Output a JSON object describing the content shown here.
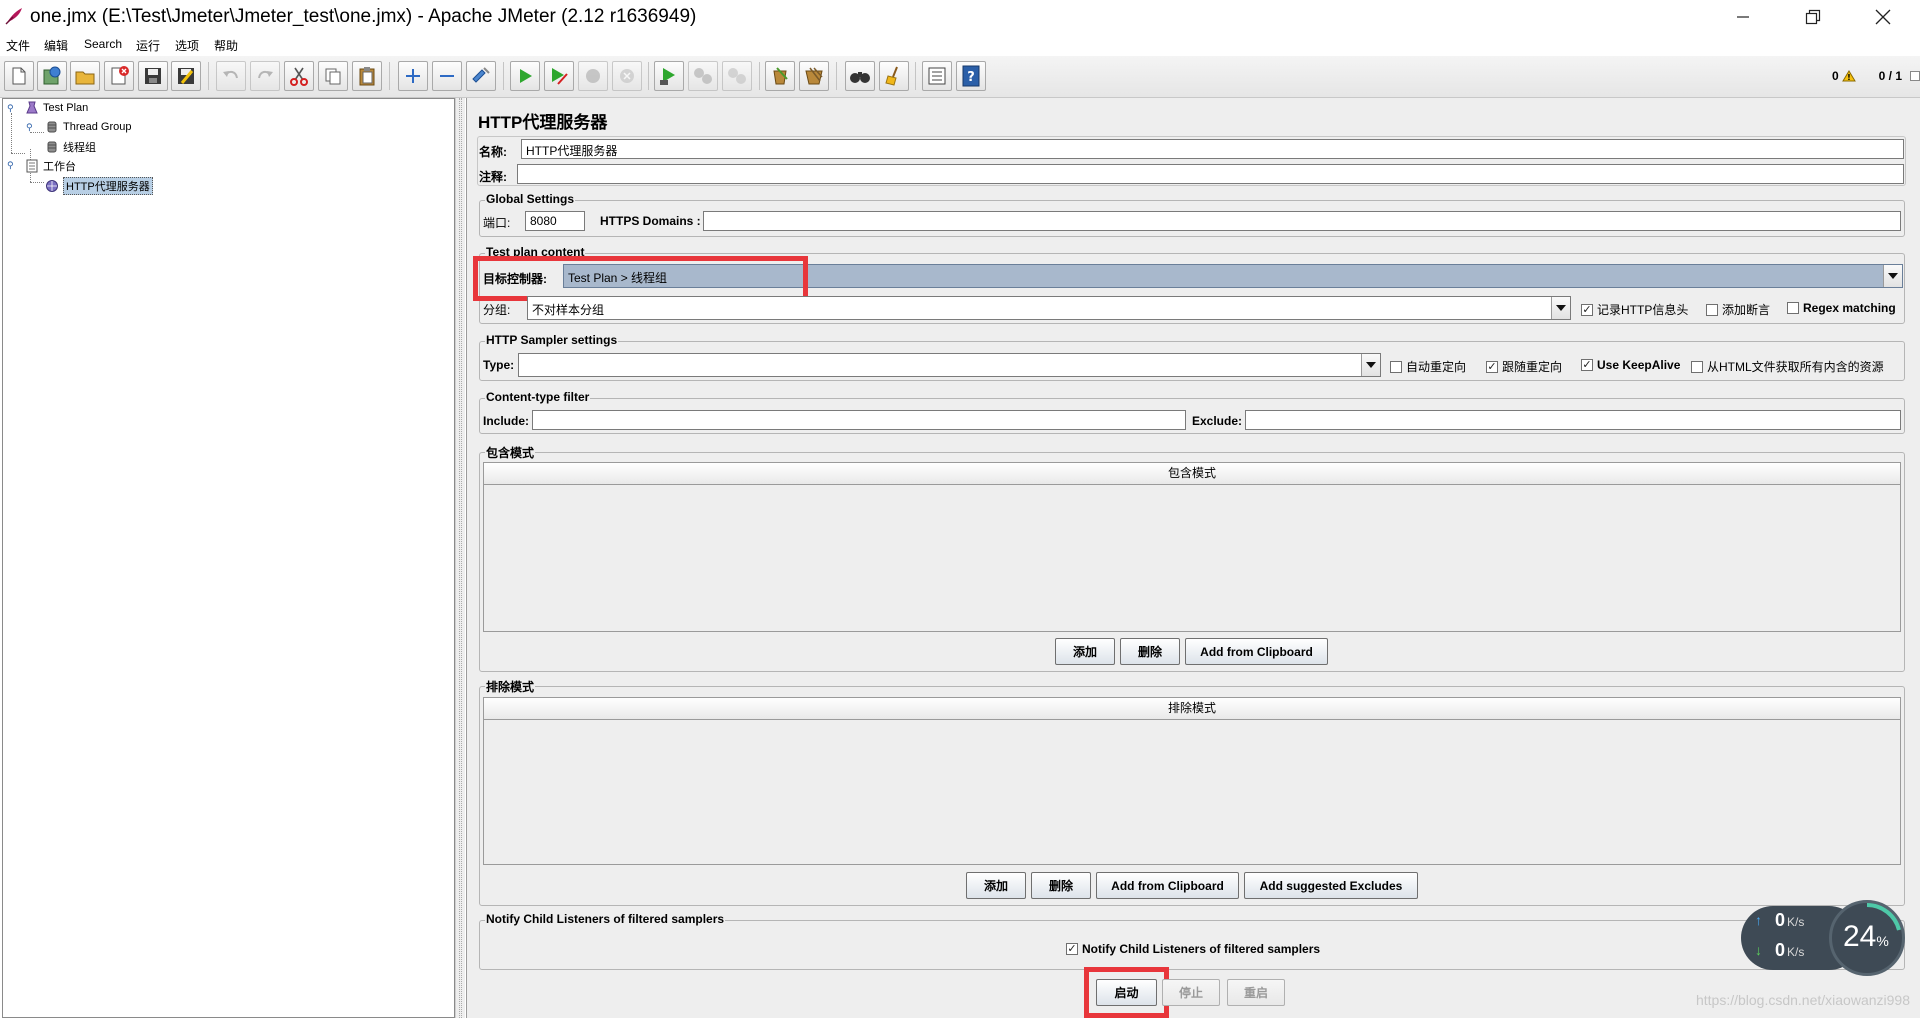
{
  "window": {
    "title": "one.jmx (E:\\Test\\Jmeter\\Jmeter_test\\one.jmx) - Apache JMeter (2.12 r1636949)"
  },
  "menu": [
    "文件",
    "编辑",
    "Search",
    "运行",
    "选项",
    "帮助"
  ],
  "toolbar": {
    "icons": [
      "new-icon",
      "templates-icon",
      "open-icon",
      "close-icon",
      "save-icon",
      "save-as-icon",
      "undo-icon",
      "redo-icon",
      "cut-icon",
      "copy-icon",
      "paste-icon",
      "expand-icon",
      "collapse-icon",
      "toggle-icon",
      "start-icon",
      "start-no-pause-icon",
      "stop-icon",
      "shutdown-icon",
      "remote-start-icon",
      "remote-stop-icon",
      "remote-shutdown-icon",
      "clear-icon",
      "clear-all-icon",
      "search-icon",
      "reset-search-icon",
      "function-helper-icon",
      "help-icon"
    ],
    "error_count": "0",
    "threads": "0 / 1"
  },
  "tree": {
    "nodes": [
      "Test Plan",
      "Thread Group",
      "线程组",
      "工作台",
      "HTTP代理服务器"
    ],
    "selected": "HTTP代理服务器"
  },
  "proxy": {
    "title": "HTTP代理服务器",
    "name_label": "名称:",
    "name_value": "HTTP代理服务器",
    "comment_label": "注释:",
    "comment_value": "",
    "global_settings": {
      "title": "Global Settings",
      "port_label": "端口:",
      "port_value": "8080",
      "https_label": "HTTPS Domains :",
      "https_value": ""
    },
    "test_plan_content": {
      "title": "Test plan content",
      "target_label": "目标控制器:",
      "target_value": "Test Plan > 线程组",
      "grouping_label": "分组:",
      "grouping_value": "不对样本分组",
      "record_headers": {
        "label": "记录HTTP信息头",
        "checked": true
      },
      "add_assertions": {
        "label": "添加断言",
        "checked": false
      },
      "regex_matching": {
        "label": "Regex matching",
        "checked": false
      }
    },
    "sampler_settings": {
      "title": "HTTP Sampler settings",
      "type_label": "Type:",
      "type_value": "",
      "auto_redirect": {
        "label": "自动重定向",
        "checked": false
      },
      "follow_redirects": {
        "label": "跟随重定向",
        "checked": true
      },
      "keepalive": {
        "label": "Use KeepAlive",
        "checked": true
      },
      "retrieve_resources": {
        "label": "从HTML文件获取所有内含的资源",
        "checked": false
      }
    },
    "content_filter": {
      "title": "Content-type filter",
      "include_label": "Include:",
      "include_value": "",
      "exclude_label": "Exclude:",
      "exclude_value": ""
    },
    "include_patterns": {
      "title": "包含模式",
      "column": "包含模式",
      "buttons": [
        "添加",
        "删除",
        "Add from Clipboard"
      ]
    },
    "exclude_patterns": {
      "title": "排除模式",
      "column": "排除模式",
      "buttons": [
        "添加",
        "删除",
        "Add from Clipboard",
        "Add suggested Excludes"
      ]
    },
    "notify": {
      "title": "Notify Child Listeners of filtered samplers",
      "checkbox": {
        "label": "Notify Child Listeners of filtered samplers",
        "checked": true
      }
    },
    "actions": {
      "start": "启动",
      "stop": "停止",
      "restart": "重启"
    }
  },
  "net_widget": {
    "up_value": "0",
    "down_value": "0",
    "unit": "K/s",
    "percent": "24",
    "percent_sign": "%"
  },
  "watermark": "https://blog.csdn.net/xiaowanzi998"
}
